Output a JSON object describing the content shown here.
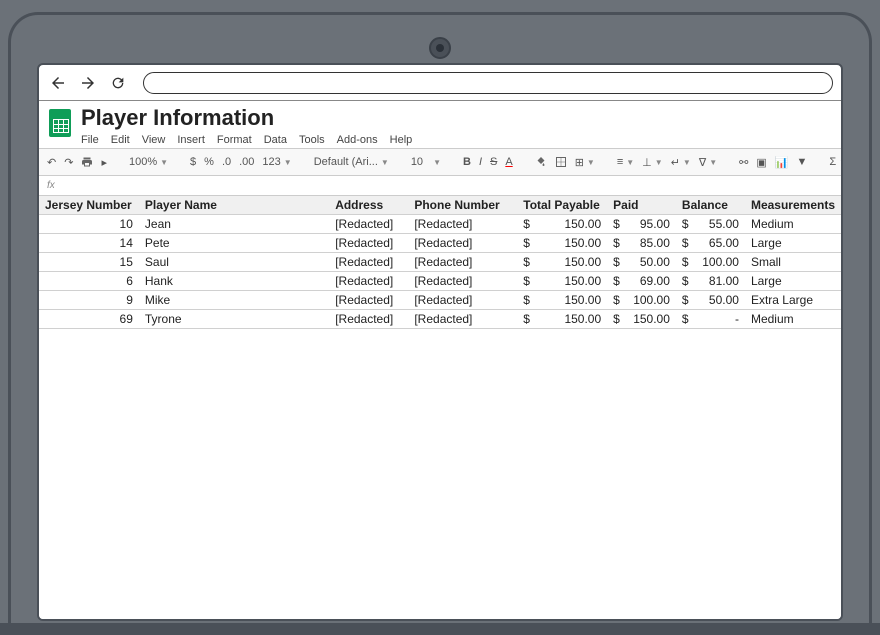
{
  "document": {
    "title": "Player Information"
  },
  "menu": {
    "file": "File",
    "edit": "Edit",
    "view": "View",
    "insert": "Insert",
    "format": "Format",
    "data": "Data",
    "tools": "Tools",
    "addons": "Add-ons",
    "help": "Help"
  },
  "toolbar": {
    "zoom": "100%",
    "currency": "$",
    "percent": "%",
    "dec_dec": ".0",
    "dec_inc": ".00",
    "num_fmt": "123",
    "font": "Default (Ari...",
    "font_size": "10",
    "bold": "B",
    "italic": "I",
    "strike": "S",
    "text_color": "A"
  },
  "fx": "fx",
  "headers": {
    "jersey": "Jersey Number",
    "name": "Player Name",
    "address": "Address",
    "phone": "Phone Number",
    "total": "Total Payable",
    "paid": "Paid",
    "balance": "Balance",
    "measurements": "Measurements"
  },
  "rows": [
    {
      "jersey": "10",
      "name": "Jean",
      "address": "[Redacted]",
      "phone": "[Redacted]",
      "total": "150.00",
      "paid": "95.00",
      "balance": "55.00",
      "measurements": "Medium"
    },
    {
      "jersey": "14",
      "name": "Pete",
      "address": "[Redacted]",
      "phone": "[Redacted]",
      "total": "150.00",
      "paid": "85.00",
      "balance": "65.00",
      "measurements": "Large"
    },
    {
      "jersey": "15",
      "name": "Saul",
      "address": "[Redacted]",
      "phone": "[Redacted]",
      "total": "150.00",
      "paid": "50.00",
      "balance": "100.00",
      "measurements": "Small"
    },
    {
      "jersey": "6",
      "name": "Hank",
      "address": "[Redacted]",
      "phone": "[Redacted]",
      "total": "150.00",
      "paid": "69.00",
      "balance": "81.00",
      "measurements": "Large"
    },
    {
      "jersey": "9",
      "name": "Mike",
      "address": "[Redacted]",
      "phone": "[Redacted]",
      "total": "150.00",
      "paid": "100.00",
      "balance": "50.00",
      "measurements": "Extra Large"
    },
    {
      "jersey": "69",
      "name": "Tyrone",
      "address": "[Redacted]",
      "phone": "[Redacted]",
      "total": "150.00",
      "paid": "150.00",
      "balance": "-",
      "measurements": "Medium"
    }
  ],
  "dollar": "$"
}
